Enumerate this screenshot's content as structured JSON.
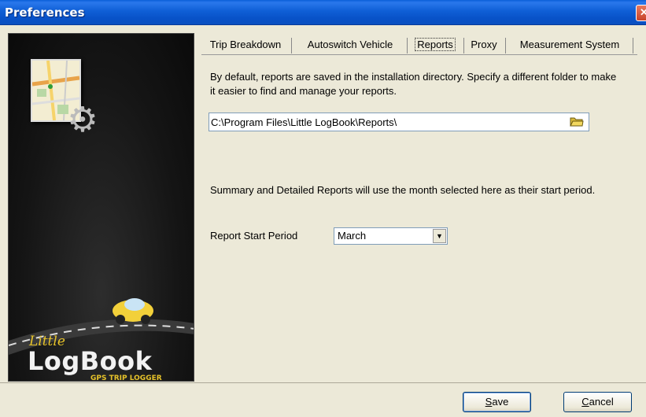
{
  "window": {
    "title": "Preferences",
    "close_glyph": "✕"
  },
  "sidebar": {
    "logo_little": "Little",
    "logo_main": "LogBook",
    "logo_tagline": "GPS TRIP LOGGER"
  },
  "tabs": [
    {
      "label": "Trip Breakdown",
      "active": false
    },
    {
      "label": "Autoswitch Vehicle",
      "active": false
    },
    {
      "label": "Reports",
      "active": true
    },
    {
      "label": "Proxy",
      "active": false
    },
    {
      "label": "Measurement System",
      "active": false
    }
  ],
  "reports": {
    "folder_description": "By default, reports are saved in the installation directory. Specify a different folder to make it easier to find and manage your reports.",
    "folder_path": "C:\\Program Files\\Little LogBook\\Reports\\",
    "period_description": "Summary and Detailed Reports will use the month selected here as their start period.",
    "period_label": "Report Start Period",
    "period_value": "March"
  },
  "buttons": {
    "save_first": "S",
    "save_rest": "ave",
    "cancel_first": "C",
    "cancel_rest": "ancel"
  },
  "colors": {
    "titlebar": "#0a5fd8",
    "dialog_bg": "#ece9d8",
    "logo_accent": "#e7c32a"
  }
}
